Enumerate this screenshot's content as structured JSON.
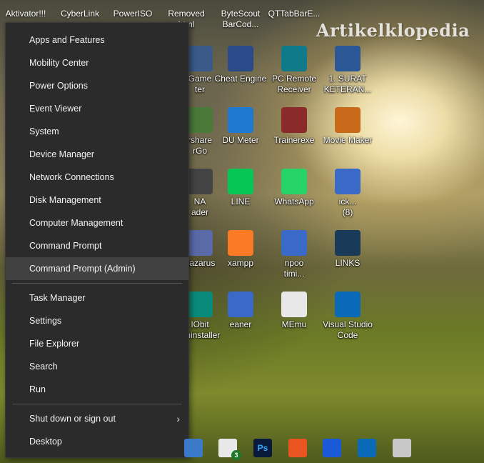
{
  "watermark": "Artikelklopedia",
  "top_row_icons": [
    {
      "label": "Aktivator!!!"
    },
    {
      "label": "CyberLink"
    },
    {
      "label": "PowerISO"
    },
    {
      "label": "Removed\nhtml"
    },
    {
      "label": "ByteScout\nBarCod..."
    },
    {
      "label": "QTTabBarE..."
    }
  ],
  "desktop_icons": [
    {
      "label": "Game\nter",
      "icon": "game-center-icon",
      "color": "#3a5a8a"
    },
    {
      "label": "Cheat Engine",
      "icon": "cheat-engine-icon",
      "color": "#2a4a8a"
    },
    {
      "label": "PC Remote\nReceiver",
      "icon": "pc-remote-icon",
      "color": "#0f7a8a"
    },
    {
      "label": "1. SURAT\nKETERAN...",
      "icon": "word-document-icon",
      "color": "#2b5797"
    },
    {
      "label": "rshare\nrGo",
      "icon": "share-go-icon",
      "color": "#4a7a3a"
    },
    {
      "label": "DU Meter",
      "icon": "du-meter-icon",
      "color": "#1e7ad0"
    },
    {
      "label": "Trainerexe",
      "icon": "trainer-icon",
      "color": "#8a2a2a"
    },
    {
      "label": "Movie Maker",
      "icon": "movie-maker-icon",
      "color": "#c86a1a"
    },
    {
      "label": "NA\nader",
      "icon": "reader-icon",
      "color": "#444444"
    },
    {
      "label": "LINE",
      "icon": "line-icon",
      "color": "#06c755"
    },
    {
      "label": "WhatsApp",
      "icon": "whatsapp-icon",
      "color": "#25d366"
    },
    {
      "label": "ick...\n(8)",
      "icon": "shield-icon",
      "color": "#3a6ac8"
    },
    {
      "label": "Lazarus",
      "icon": "lazarus-icon",
      "color": "#5a6aa8"
    },
    {
      "label": "xampp",
      "icon": "xampp-icon",
      "color": "#fb7a24"
    },
    {
      "label": "npoo\ntimi...",
      "icon": "shield-icon",
      "color": "#3a6ac8"
    },
    {
      "label": "LINKS",
      "icon": "links-icon",
      "color": "#1a3a5a"
    },
    {
      "label": "IObit\nUninstaller",
      "icon": "iobit-icon",
      "color": "#0a8a7a"
    },
    {
      "label": "eaner",
      "icon": "shield-icon",
      "color": "#3a6ac8"
    },
    {
      "label": "MEmu",
      "icon": "memu-icon",
      "color": "#e8e8e8"
    },
    {
      "label": "Visual Studio\nCode",
      "icon": "vscode-icon",
      "color": "#0a6ab8"
    }
  ],
  "menu": {
    "group1": [
      "Apps and Features",
      "Mobility Center",
      "Power Options",
      "Event Viewer",
      "System",
      "Device Manager",
      "Network Connections",
      "Disk Management",
      "Computer Management",
      "Command Prompt",
      "Command Prompt (Admin)"
    ],
    "group2": [
      "Task Manager",
      "Settings",
      "File Explorer",
      "Search",
      "Run"
    ],
    "group3": [
      "Shut down or sign out",
      "Desktop"
    ],
    "highlighted": "Command Prompt (Admin)",
    "submenu_arrow": "›"
  },
  "taskbar": {
    "mail_badge": "3",
    "icons": [
      "store-icon",
      "mail-icon",
      "photoshop-icon",
      "ubuntu-icon",
      "firefox-icon",
      "vscode-icon",
      "app-icon"
    ],
    "photoshop_label": "Ps"
  }
}
